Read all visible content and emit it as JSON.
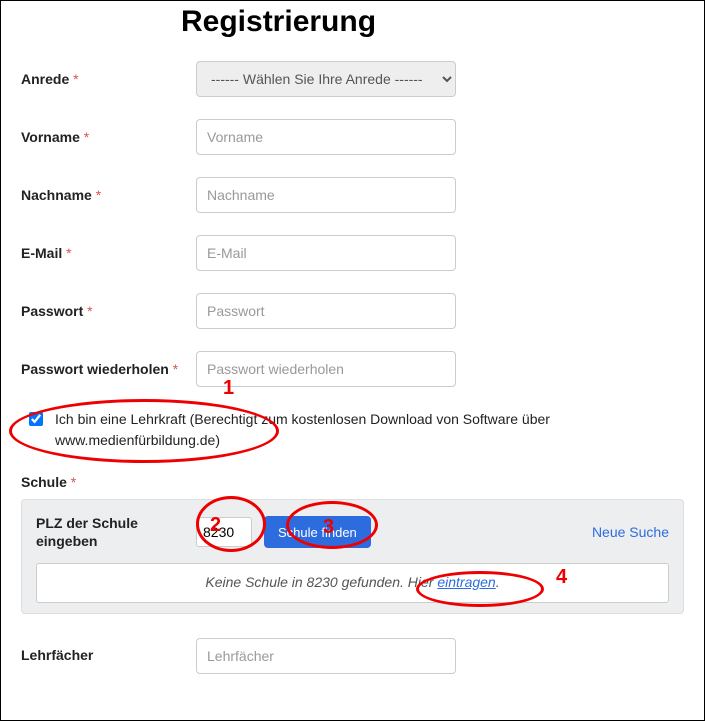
{
  "title": "Registrierung",
  "fields": {
    "anrede": {
      "label": "Anrede",
      "select_placeholder": "------ Wählen Sie Ihre Anrede ------"
    },
    "vorname": {
      "label": "Vorname",
      "placeholder": "Vorname"
    },
    "nachname": {
      "label": "Nachname",
      "placeholder": "Nachname"
    },
    "email": {
      "label": "E-Mail",
      "placeholder": "E-Mail"
    },
    "passwort": {
      "label": "Passwort",
      "placeholder": "Passwort"
    },
    "passwort2": {
      "label": "Passwort wiederholen",
      "placeholder": "Passwort wiederholen"
    },
    "lehrfaecher": {
      "label": "Lehrfächer",
      "placeholder": "Lehrfächer"
    }
  },
  "checkbox": {
    "checked": true,
    "label": "Ich bin eine Lehrkraft (Berechtigt zum kostenlosen Download von Software über www.medienfürbildung.de)"
  },
  "schule": {
    "section_label": "Schule",
    "plz_label": "PLZ der Schule eingeben",
    "plz_value": "8230",
    "find_button": "Schule finden",
    "neue_suche": "Neue Suche",
    "result_prefix": "Keine Schule in 8230 gefunden. Hier ",
    "result_link": "eintragen",
    "result_suffix": "."
  },
  "annotations": {
    "n1": "1",
    "n2": "2",
    "n3": "3",
    "n4": "4"
  }
}
